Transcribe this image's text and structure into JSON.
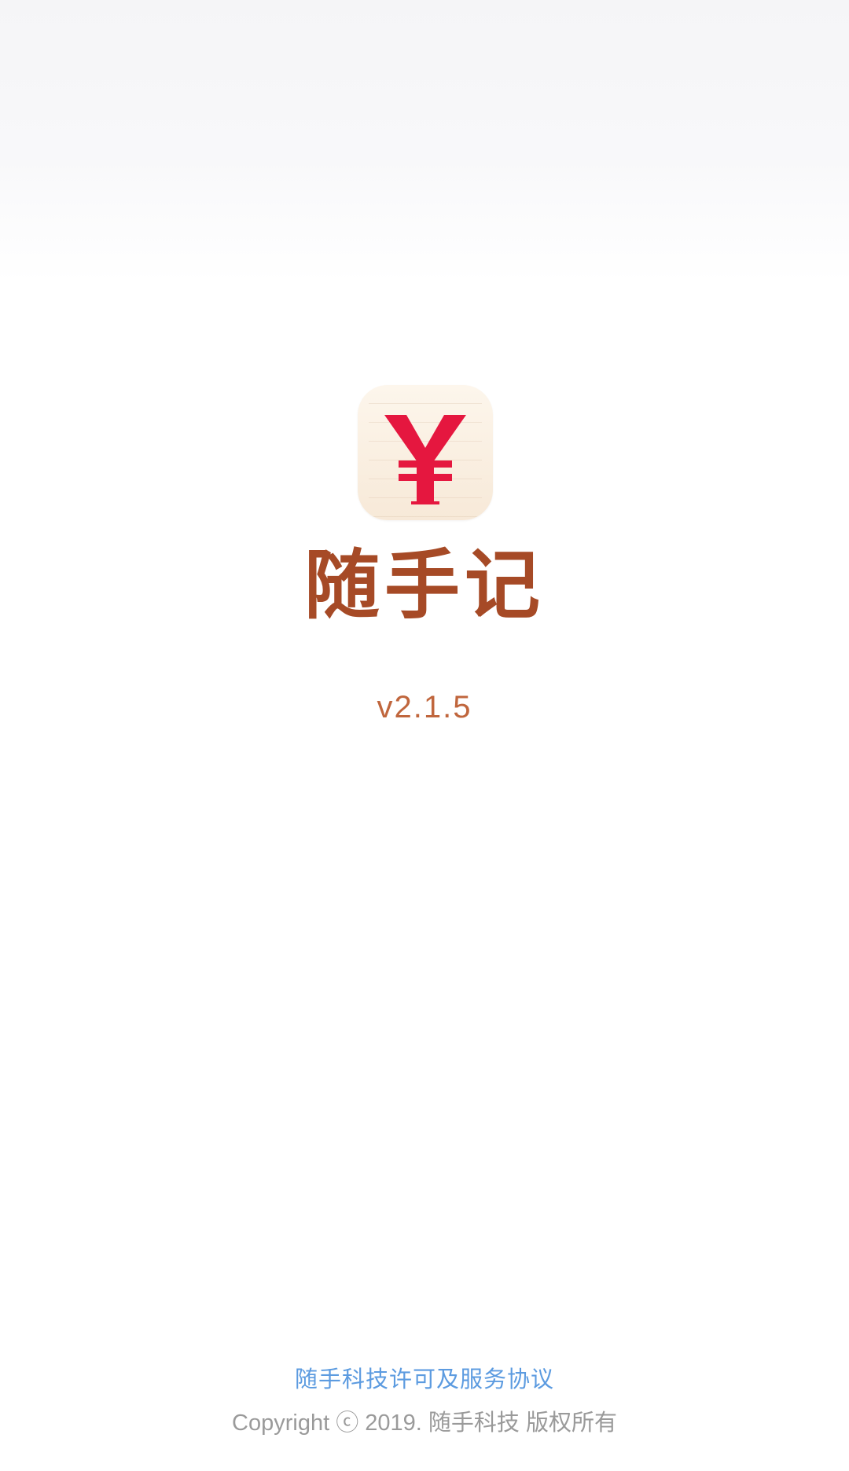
{
  "splash": {
    "app_icon": "yen-icon",
    "app_name": "随手记",
    "version": "v2.1.5"
  },
  "footer": {
    "license_link": "随手科技许可及服务协议",
    "copyright": "Copyright ⓒ 2019. 随手科技 版权所有"
  },
  "colors": {
    "brand_red": "#e5173f",
    "title_brown": "#a64a26",
    "version_orange": "#c0663d",
    "link_blue": "#5c9be0",
    "copyright_gray": "#9a9a9a"
  }
}
